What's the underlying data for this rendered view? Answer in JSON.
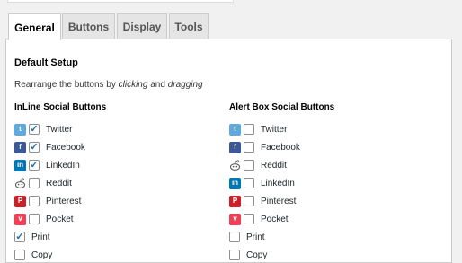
{
  "tabs": [
    {
      "label": "General",
      "active": true
    },
    {
      "label": "Buttons",
      "active": false
    },
    {
      "label": "Display",
      "active": false
    },
    {
      "label": "Tools",
      "active": false
    }
  ],
  "panel": {
    "heading": "Default Setup",
    "desc_before": "Rearrange the buttons by ",
    "desc_em1": "clicking",
    "desc_mid": " and ",
    "desc_em2": "dragging"
  },
  "inline": {
    "title": "InLine Social Buttons",
    "items": [
      {
        "label": "Twitter",
        "checked": true,
        "icon": "twitter-icon"
      },
      {
        "label": "Facebook",
        "checked": true,
        "icon": "facebook-icon"
      },
      {
        "label": "LinkedIn",
        "checked": true,
        "icon": "linkedin-icon"
      },
      {
        "label": "Reddit",
        "checked": false,
        "icon": "reddit-icon"
      },
      {
        "label": "Pinterest",
        "checked": false,
        "icon": "pinterest-icon"
      },
      {
        "label": "Pocket",
        "checked": false,
        "icon": "pocket-icon"
      },
      {
        "label": "Print",
        "checked": true,
        "icon": ""
      },
      {
        "label": "Copy",
        "checked": false,
        "icon": ""
      }
    ]
  },
  "alertbox": {
    "title": "Alert Box Social Buttons",
    "items": [
      {
        "label": "Twitter",
        "checked": false,
        "icon": "twitter-icon"
      },
      {
        "label": "Facebook",
        "checked": false,
        "icon": "facebook-icon"
      },
      {
        "label": "Reddit",
        "checked": false,
        "icon": "reddit-icon"
      },
      {
        "label": "LinkedIn",
        "checked": false,
        "icon": "linkedin-icon"
      },
      {
        "label": "Pinterest",
        "checked": false,
        "icon": "pinterest-icon"
      },
      {
        "label": "Pocket",
        "checked": false,
        "icon": "pocket-icon"
      },
      {
        "label": "Print",
        "checked": false,
        "icon": ""
      },
      {
        "label": "Copy",
        "checked": false,
        "icon": ""
      }
    ]
  },
  "colors": {
    "twitter": "#5ea9dd",
    "facebook": "#3b5998",
    "linkedin": "#0077b5",
    "pinterest": "#cb2027",
    "pocket": "#ef4056",
    "checkmark": "#1e6eb0"
  }
}
